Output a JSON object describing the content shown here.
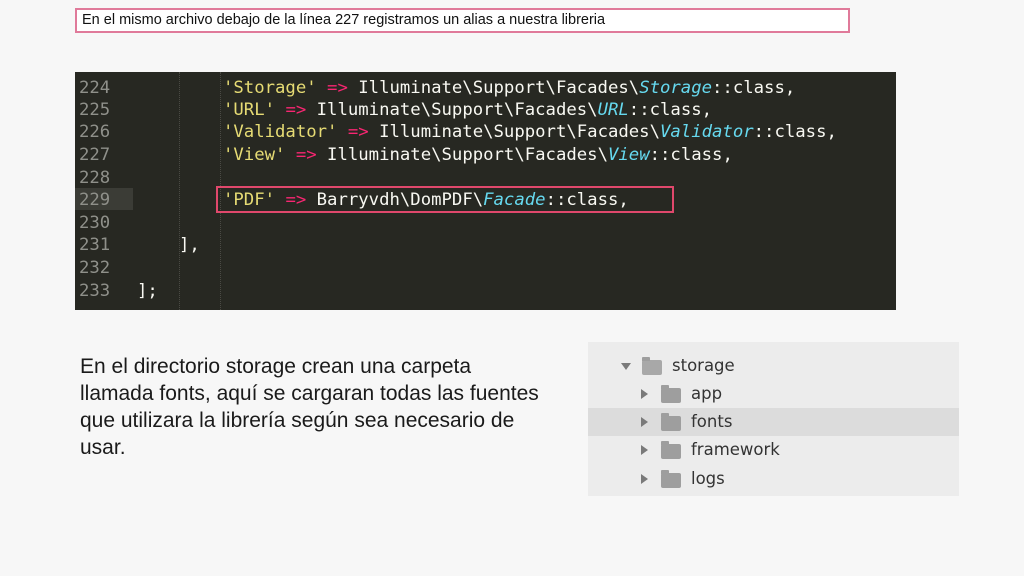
{
  "caption": "En el mismo archivo debajo de la línea 227 registramos un alias a nuestra libreria",
  "editor": {
    "lines": [
      {
        "num": "224",
        "key": "'Storage'",
        "arrow": "=>",
        "ns": " Illuminate\\Support\\Facades\\",
        "cls": "Storage",
        "tail": "::class,"
      },
      {
        "num": "225",
        "key": "'URL'",
        "arrow": "=>",
        "ns": " Illuminate\\Support\\Facades\\",
        "cls": "URL",
        "tail": "::class,"
      },
      {
        "num": "226",
        "key": "'Validator'",
        "arrow": "=>",
        "ns": " Illuminate\\Support\\Facades\\",
        "cls": "Validator",
        "tail": "::class,"
      },
      {
        "num": "227",
        "key": "'View'",
        "arrow": "=>",
        "ns": " Illuminate\\Support\\Facades\\",
        "cls": "View",
        "tail": "::class,"
      },
      {
        "num": "228"
      },
      {
        "num": "229",
        "key": "'PDF'",
        "arrow": "=>",
        "ns": " Barryvdh\\DomPDF\\",
        "cls": "Facade",
        "tail": "::class,"
      },
      {
        "num": "230"
      },
      {
        "num": "231",
        "plain": "],"
      },
      {
        "num": "232"
      },
      {
        "num": "233",
        "plain": "];"
      }
    ],
    "colors": {
      "background": "#272822",
      "string": "#e6db74",
      "operator": "#f92672",
      "class": "#66d9ef",
      "highlight_box": "#e0486c"
    }
  },
  "description": "En el directorio storage crean una carpeta llamada fonts, aquí se cargaran todas las fuentes que utilizara la librería según sea necesario de usar.",
  "tree": {
    "root": "storage",
    "children": [
      "app",
      "fonts",
      "framework",
      "logs"
    ],
    "selected": "fonts"
  }
}
